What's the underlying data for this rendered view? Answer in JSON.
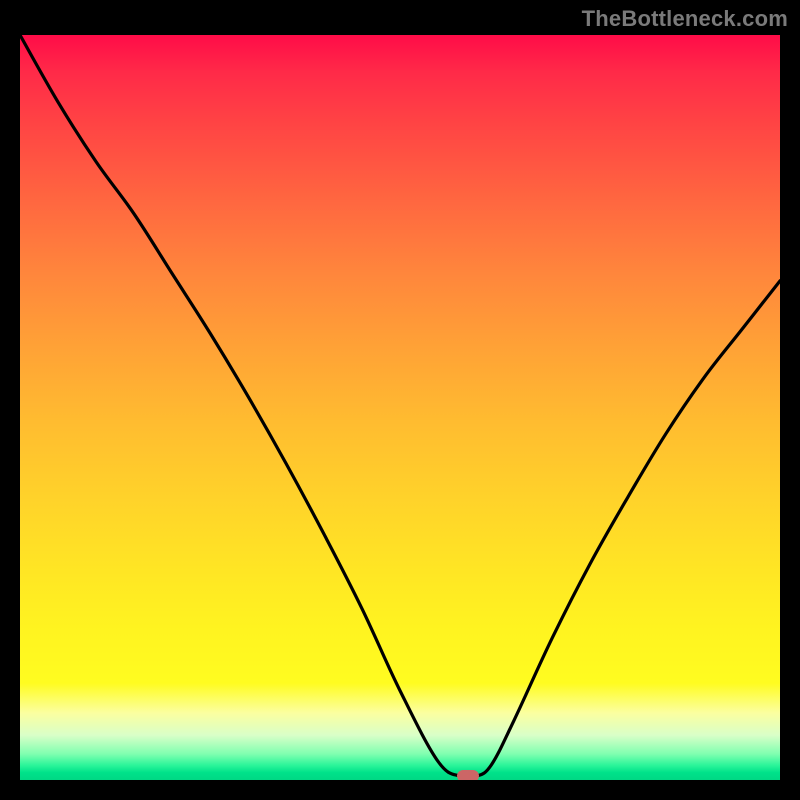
{
  "watermark": "TheBottleneck.com",
  "colors": {
    "background": "#000000",
    "curve": "#000000",
    "marker": "#cc6666",
    "gradient_top": "#ff0c48",
    "gradient_bottom": "#00d884"
  },
  "chart_data": {
    "type": "line",
    "title": "",
    "xlabel": "",
    "ylabel": "",
    "xlim": [
      0,
      100
    ],
    "ylim": [
      0,
      100
    ],
    "grid": false,
    "legend": false,
    "series": [
      {
        "name": "bottleneck-curve",
        "x": [
          0,
          5,
          10,
          15,
          20,
          25,
          30,
          35,
          40,
          45,
          50,
          55,
          58,
          60,
          62,
          65,
          70,
          75,
          80,
          85,
          90,
          95,
          100
        ],
        "values": [
          100,
          91,
          83,
          76,
          68,
          60,
          51.5,
          42.5,
          33,
          23,
          12,
          2.5,
          0.5,
          0.5,
          2,
          8,
          19,
          29,
          38,
          46.5,
          54,
          60.5,
          67
        ]
      }
    ],
    "marker": {
      "x": 59,
      "y": 0.5
    }
  }
}
